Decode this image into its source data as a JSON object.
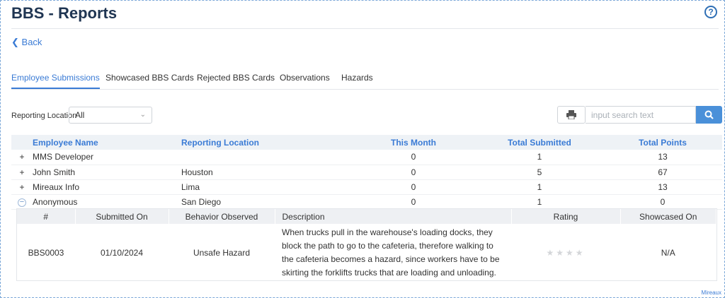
{
  "page": {
    "title": "BBS - Reports",
    "help_icon": "?",
    "back_label": "Back",
    "footer_brand": "Mireaux"
  },
  "tabs": [
    {
      "label": "Employee Submissions",
      "active": true
    },
    {
      "label": "Showcased BBS Cards",
      "active": false
    },
    {
      "label": "Rejected BBS Cards",
      "active": false
    },
    {
      "label": "Observations",
      "active": false
    },
    {
      "label": "Hazards",
      "active": false
    }
  ],
  "filters": {
    "location_label": "Reporting Location",
    "location_value": "All",
    "search_placeholder": "input search text"
  },
  "table": {
    "headers": [
      "Employee Name",
      "Reporting Location",
      "This Month",
      "Total Submitted",
      "Total Points"
    ],
    "rows": [
      {
        "expander": "+",
        "name": "MMS Developer",
        "location": "",
        "this_month": "0",
        "total_submitted": "1",
        "total_points": "13"
      },
      {
        "expander": "+",
        "name": "John Smith",
        "location": "Houston",
        "this_month": "0",
        "total_submitted": "5",
        "total_points": "67"
      },
      {
        "expander": "+",
        "name": "Mireaux Info",
        "location": "Lima",
        "this_month": "0",
        "total_submitted": "1",
        "total_points": "13"
      },
      {
        "expander": "−",
        "name": "Anonymous",
        "location": "San Diego",
        "this_month": "0",
        "total_submitted": "1",
        "total_points": "0"
      }
    ]
  },
  "detail": {
    "headers": [
      "#",
      "Submitted On",
      "Behavior Observed",
      "Description",
      "Rating",
      "Showcased On"
    ],
    "row": {
      "id": "BBS0003",
      "submitted_on": "01/10/2024",
      "behavior": "Unsafe Hazard",
      "description": "When trucks pull in the warehouse's loading docks, they block the path to go to the cafeteria, therefore walking to the cafeteria becomes a hazard, since workers have to be skirting the forklifts trucks that are loading and unloading.",
      "rating": 0,
      "rating_max": 4,
      "showcased_on": "N/A"
    }
  },
  "colors": {
    "accent": "#3a7bd5",
    "title": "#1f3552",
    "search_button": "#4a90d9"
  }
}
